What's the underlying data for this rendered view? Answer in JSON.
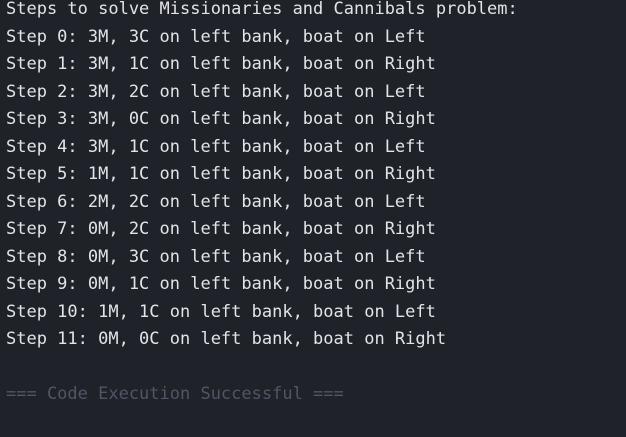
{
  "console": {
    "header": "Steps to solve Missionaries and Cannibals problem:",
    "steps": [
      "Step 0: 3M, 3C on left bank, boat on Left",
      "Step 1: 3M, 1C on left bank, boat on Right",
      "Step 2: 3M, 2C on left bank, boat on Left",
      "Step 3: 3M, 0C on left bank, boat on Right",
      "Step 4: 3M, 1C on left bank, boat on Left",
      "Step 5: 1M, 1C on left bank, boat on Right",
      "Step 6: 2M, 2C on left bank, boat on Left",
      "Step 7: 0M, 2C on left bank, boat on Right",
      "Step 8: 0M, 3C on left bank, boat on Left",
      "Step 9: 0M, 1C on left bank, boat on Right",
      "Step 10: 1M, 1C on left bank, boat on Left",
      "Step 11: 0M, 0C on left bank, boat on Right"
    ],
    "status": "=== Code Execution Successful ==="
  },
  "colors": {
    "background": "#1f2229",
    "text": "#e2e4e8",
    "status_text": "#4f5664"
  }
}
